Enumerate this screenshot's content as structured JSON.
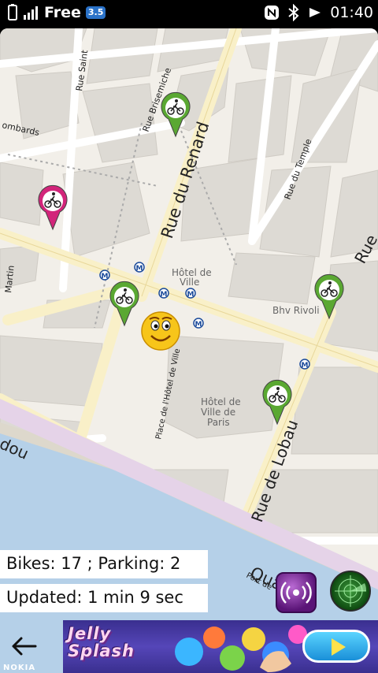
{
  "status_bar": {
    "carrier": "Free",
    "network_badge": "3.5",
    "time": "01:40",
    "icons": [
      "signal-bars-icon",
      "nfc-icon",
      "bluetooth-icon",
      "sound-icon"
    ]
  },
  "map": {
    "street_labels": {
      "rue_du_renard": "Rue du Renard",
      "rue_brisemiche": "Rue Brisemiche",
      "rue_saint": "Rue Saint",
      "rue_du_temple": "Rue du Temple",
      "rue_de_lobau": "Rue de Lobau",
      "quai": "Quai",
      "lombards": "ombards",
      "martin": "Martin",
      "dou": "dou",
      "place_hotel_de_ville": "Place de l'Hôtel de Ville",
      "port": "Port de",
      "rue_fragment": "Rue"
    },
    "poi_labels": {
      "hotel_de_ville_1": "Hôtel de",
      "hotel_de_ville_2": "Ville",
      "bhv_rivoli": "Bhv Rivoli",
      "hotel_paris_1": "Hôtel de",
      "hotel_paris_2": "Ville de",
      "hotel_paris_3": "Paris"
    },
    "metro_symbol": "M",
    "markers": [
      {
        "type": "bike-station",
        "color": "#5aa832"
      },
      {
        "type": "bike-station",
        "color": "#d2257a"
      },
      {
        "type": "bike-station",
        "color": "#5aa832"
      },
      {
        "type": "bike-station",
        "color": "#5aa832"
      },
      {
        "type": "bike-station",
        "color": "#5aa832"
      }
    ],
    "user_location_icon": "smiley-face-icon"
  },
  "info": {
    "bikes_text": "Bikes: 17 ; Parking: 2",
    "updated_text": "Updated: 1 min 9 sec"
  },
  "controls": {
    "speaker_icon": "speaker-waves-icon",
    "radar_icon": "radar-icon",
    "back_icon": "back-arrow-icon"
  },
  "ad": {
    "title_line1": "Jelly",
    "title_line2": "Splash"
  },
  "device": {
    "brand": "NOKIA"
  }
}
